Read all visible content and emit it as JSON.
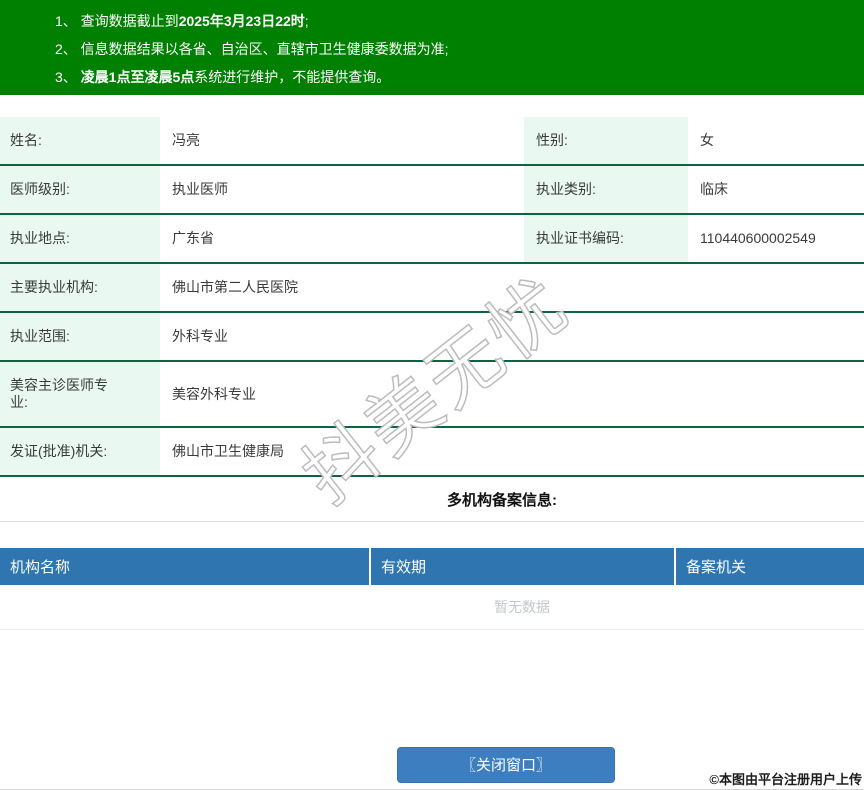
{
  "colors": {
    "notice_bg": "#008000",
    "label_bg": "#e9f9f1",
    "row_border": "#0e6340",
    "filing_header_bg": "#2f76b1",
    "button_bg": "#3c7ebf"
  },
  "notice": {
    "lines": [
      {
        "pre": "1、 查询数据截止到",
        "bold": "2025年3月23日22时",
        "post": ";"
      },
      {
        "pre": "2、 信息数据结果以各省、自治区、直辖市卫生健康委数据为准;",
        "bold": "",
        "post": ""
      },
      {
        "pre": "3、 ",
        "bold": "凌晨1点至凌晨5点",
        "post": "系统进行维护，不能提供查询。"
      }
    ]
  },
  "profile": {
    "rows": [
      {
        "label": "姓名:",
        "value": "冯亮",
        "label2": "性别:",
        "value2": "女"
      },
      {
        "label": "医师级别:",
        "value": "执业医师",
        "label2": "执业类别:",
        "value2": "临床"
      },
      {
        "label": "执业地点:",
        "value": "广东省",
        "label2": "执业证书编码:",
        "value2": "110440600002549"
      },
      {
        "label": "主要执业机构:",
        "value": "佛山市第二人民医院"
      },
      {
        "label": "执业范围:",
        "value": "外科专业"
      },
      {
        "label": "美容主诊医师专业:",
        "value": "美容外科专业"
      },
      {
        "label": "发证(批准)机关:",
        "value": "佛山市卫生健康局"
      }
    ]
  },
  "filing": {
    "title": "多机构备案信息:",
    "columns": [
      "机构名称",
      "有效期",
      "备案机关"
    ],
    "empty_text": "暂无数据"
  },
  "watermark": "抖美无忧",
  "footer": {
    "close_button_label": "〖关闭窗口〗",
    "copyright": "©本图由平台注册用户上传"
  }
}
